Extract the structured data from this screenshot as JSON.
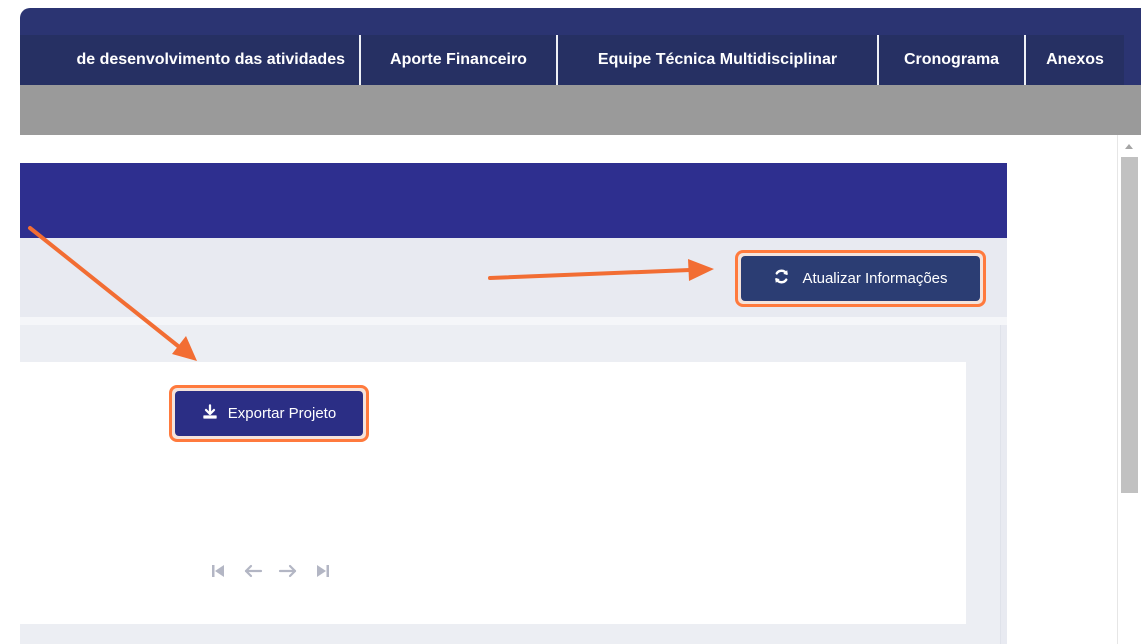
{
  "nav": {
    "tabs": [
      {
        "label": "de desenvolvimento das atividades"
      },
      {
        "label": "Aporte Financeiro"
      },
      {
        "label": "Equipe Técnica Multidisciplinar"
      },
      {
        "label": "Cronograma"
      },
      {
        "label": "Anexos"
      }
    ]
  },
  "actions": {
    "update_label": "Atualizar Informações",
    "export_label": "Exportar Projeto"
  },
  "pager": {
    "icons": [
      "first-page-icon",
      "prev-page-icon",
      "next-page-icon",
      "last-page-icon"
    ]
  },
  "colors": {
    "nav_bg": "#2b3472",
    "panel_header": "#2e2f8f",
    "button_update": "#2b3d73",
    "button_export": "#2b2e85",
    "highlight": "#ff7a3d",
    "annotation_arrow": "#f26d33"
  }
}
